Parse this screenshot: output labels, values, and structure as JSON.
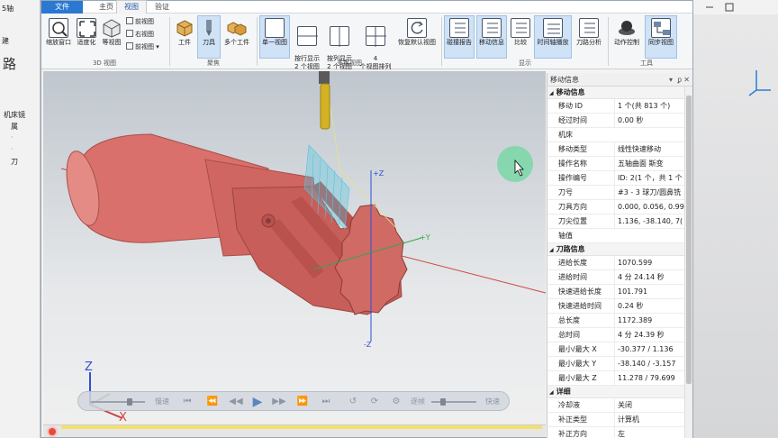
{
  "background_app": {
    "top_label": "5轴",
    "mid_label": "建",
    "side_label": "路",
    "tree_label": "机床镜",
    "tree_item": "属",
    "tree_item2": "刀"
  },
  "tabs": {
    "file": "文件",
    "main": "主页",
    "view": "视图",
    "verify": "验证"
  },
  "ribbon": {
    "view3d": {
      "zoom_window": "缩放窗口",
      "fit": "适度化",
      "iso": "等视图",
      "front": "前视图",
      "right": "右视图",
      "back": "前视图",
      "group": "3D 视图"
    },
    "focus": {
      "workpiece": "工件",
      "tool": "刀具",
      "multi": "多个工件",
      "group": "聚焦"
    },
    "multiview": {
      "single": "单一视图",
      "rows2": "按行显示\n2 个视图",
      "cols2": "按列显示\n2 个视图",
      "four": "4\n个视图排列",
      "restore": "恢复默认视图",
      "group": "多重视图"
    },
    "show": {
      "collision": "碰撞报告",
      "move_info": "移动信息",
      "compare": "比较",
      "timeline": "时间轴播放",
      "tool_analysis": "刀路分析",
      "group": "显示"
    },
    "tools": {
      "motion": "动作控制",
      "sync": "同步视图",
      "group": "工具"
    }
  },
  "panel": {
    "title": "移动信息",
    "sections": [
      {
        "name": "移动信息",
        "rows": [
          [
            "移动 ID",
            "1 个(共 813 个)"
          ],
          [
            "经过时间",
            "0.00 秒"
          ],
          [
            "机床",
            ""
          ],
          [
            "移动类型",
            "线性快速移动"
          ],
          [
            "操作名称",
            "五轴曲面 斯变"
          ],
          [
            "操作编号",
            "ID: 2(1 个，共 1 个"
          ],
          [
            "刀号",
            "#3 - 3 球刀/圆鼻铣"
          ],
          [
            "刀具方向",
            "0.000, 0.056, 0.99"
          ],
          [
            "刀尖位置",
            "1.136, -38.140, 7("
          ],
          [
            "轴值",
            ""
          ]
        ]
      },
      {
        "name": "刀路信息",
        "rows": [
          [
            "进给长度",
            "1070.599"
          ],
          [
            "进给时间",
            "4 分 24.14 秒"
          ],
          [
            "快速进给长度",
            "101.791"
          ],
          [
            "快速进给时间",
            "0.24 秒"
          ],
          [
            "总长度",
            "1172.389"
          ],
          [
            "总时间",
            "4 分 24.39 秒"
          ],
          [
            "最小/最大 X",
            "-30.377 / 1.136"
          ],
          [
            "最小/最大 Y",
            "-38.140 / -3.157"
          ],
          [
            "最小/最大 Z",
            "11.278 / 79.699"
          ]
        ]
      },
      {
        "name": "详细",
        "rows": [
          [
            "冷却液",
            "关闭"
          ],
          [
            "补正类型",
            "计算机"
          ],
          [
            "补正方向",
            "左"
          ]
        ]
      }
    ]
  },
  "viewport": {
    "axis_labels": {
      "z_plus": "+Z",
      "y_plus": "+Y",
      "z_minus": "-Z",
      "big_z": "Z",
      "big_x": "X"
    }
  },
  "playbar": {
    "slow": "慢速",
    "fast": "快速",
    "step": "逐帧"
  },
  "colors": {
    "part": "#d9706b",
    "toolpath": "#4fc6e0",
    "tool_holder": "#d4b224",
    "accent": "#2b78d3"
  }
}
